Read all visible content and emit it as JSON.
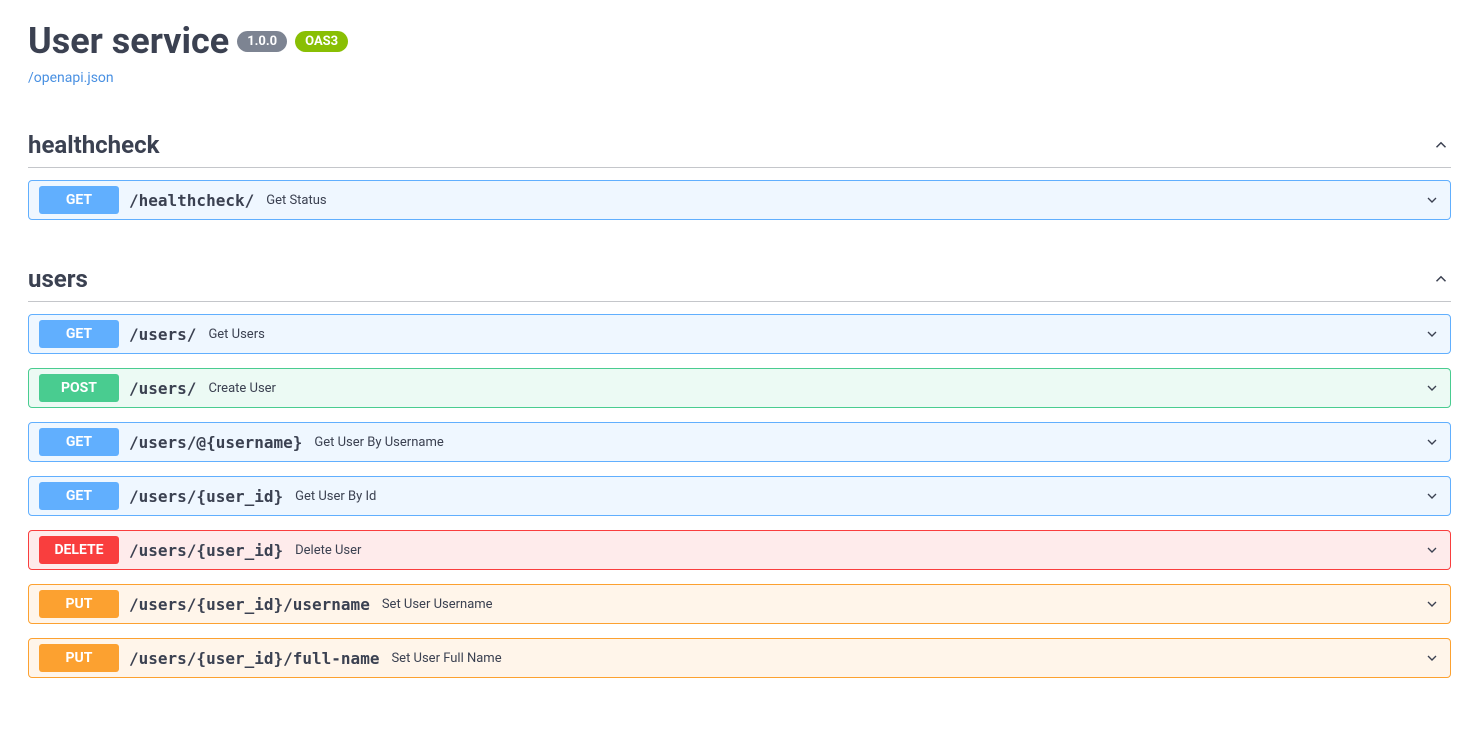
{
  "header": {
    "title": "User service",
    "version": "1.0.0",
    "oas_badge": "OAS3",
    "spec_link": "/openapi.json"
  },
  "tags": [
    {
      "name": "healthcheck",
      "expanded": true,
      "operations": [
        {
          "method": "GET",
          "path": "/healthcheck/",
          "summary": "Get Status"
        }
      ]
    },
    {
      "name": "users",
      "expanded": true,
      "operations": [
        {
          "method": "GET",
          "path": "/users/",
          "summary": "Get Users"
        },
        {
          "method": "POST",
          "path": "/users/",
          "summary": "Create User"
        },
        {
          "method": "GET",
          "path": "/users/@{username}",
          "summary": "Get User By Username"
        },
        {
          "method": "GET",
          "path": "/users/{user_id}",
          "summary": "Get User By Id"
        },
        {
          "method": "DELETE",
          "path": "/users/{user_id}",
          "summary": "Delete User"
        },
        {
          "method": "PUT",
          "path": "/users/{user_id}/username",
          "summary": "Set User Username"
        },
        {
          "method": "PUT",
          "path": "/users/{user_id}/full-name",
          "summary": "Set User Full Name"
        }
      ]
    }
  ]
}
